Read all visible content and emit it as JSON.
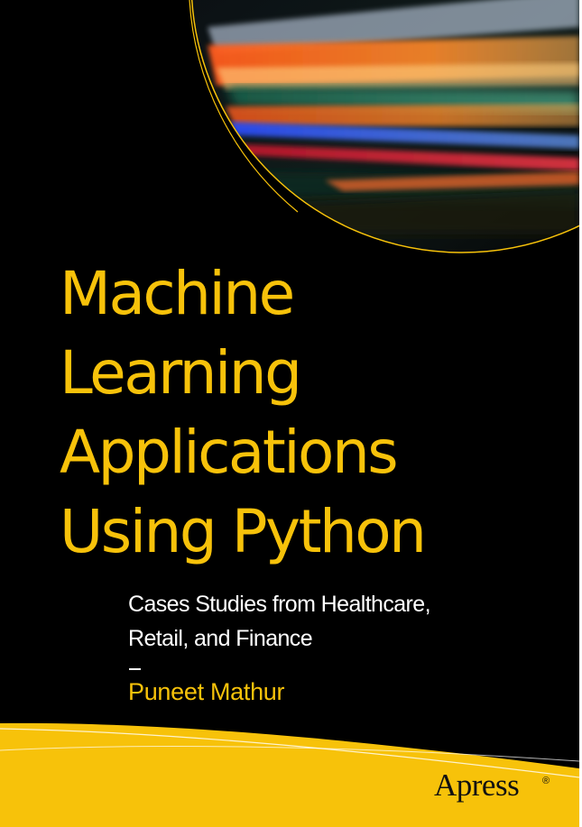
{
  "book": {
    "title_lines": [
      "Machine",
      "Learning",
      "Applications",
      "Using Python"
    ],
    "subtitle_lines": [
      "Cases Studies from Healthcare,",
      "Retail, and Finance"
    ],
    "author": "Puneet Mathur",
    "publisher": "Apress",
    "registered_mark": "®"
  },
  "colors": {
    "background": "#000000",
    "accent_yellow": "#f7c20a",
    "subtitle_text": "#ffffff"
  },
  "icons": {
    "header_art": "light-trails-image",
    "footer_art": "yellow-wave-band"
  }
}
